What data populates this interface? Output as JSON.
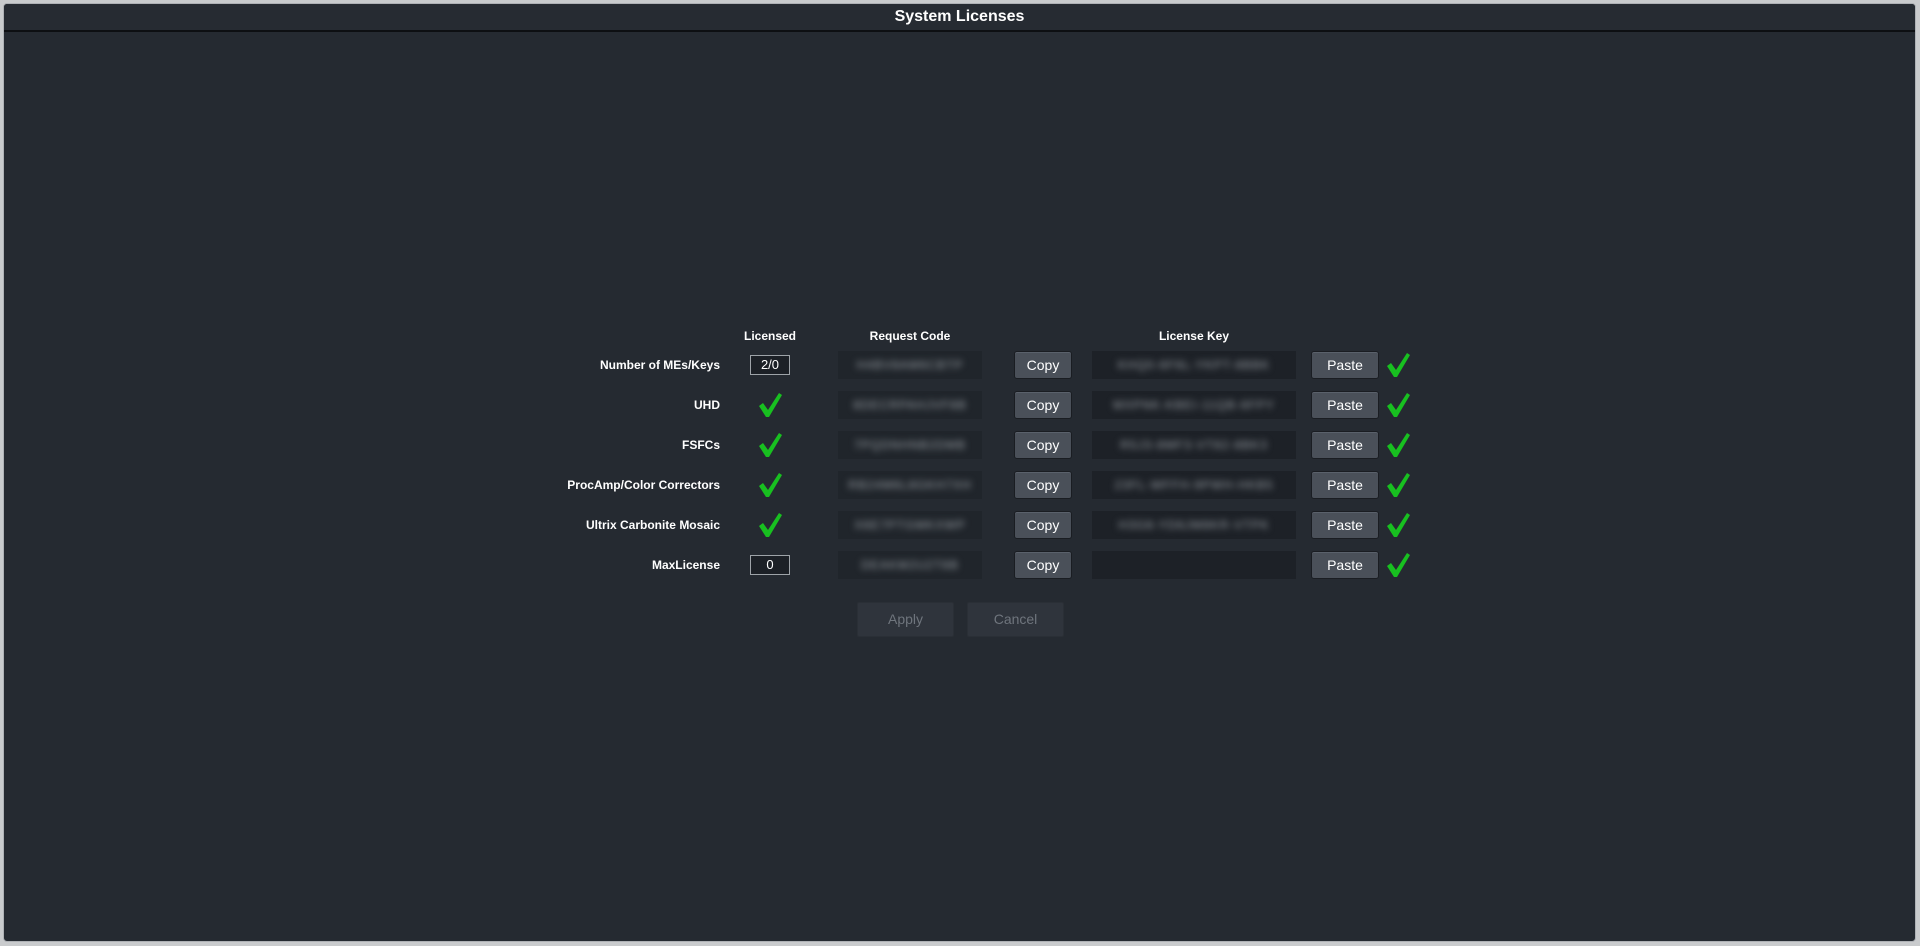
{
  "window": {
    "title": "System Licenses"
  },
  "headers": {
    "licensed": "Licensed",
    "request_code": "Request Code",
    "license_key": "License Key"
  },
  "colors": {
    "background": "#252a31",
    "check": "#18c020",
    "button": "#4a5059"
  },
  "rows": [
    {
      "label": "Number of MEs/Keys",
      "licensed_type": "value",
      "licensed_value": "2/0",
      "request_code": "H4BV8AM6CBTP",
      "copy_label": "Copy",
      "license_key": "KHQ0-6F6L-YKPT-8BBK",
      "paste_label": "Paste",
      "status_icon": "check-icon"
    },
    {
      "label": "UHD",
      "licensed_type": "check",
      "licensed_icon": "check-icon",
      "request_code": "8DECRPAHJVF8B",
      "copy_label": "Copy",
      "license_key": "MXPNK-KBEI-11QB-6FPY",
      "paste_label": "Paste",
      "status_icon": "check-icon"
    },
    {
      "label": "FSFCs",
      "licensed_type": "check",
      "licensed_icon": "check-icon",
      "request_code": "7PQDNHNB2DMB",
      "copy_label": "Copy",
      "license_key": "R5J3-8MF3-VT82-8BK3",
      "paste_label": "Paste",
      "status_icon": "check-icon"
    },
    {
      "label": "ProcAmp/Color Correctors",
      "licensed_type": "check",
      "licensed_icon": "check-icon",
      "request_code": "RB24M6L8GKH7XH",
      "copy_label": "Copy",
      "license_key": "23FL-WFFH-9PWH-HKB5",
      "paste_label": "Paste",
      "status_icon": "check-icon"
    },
    {
      "label": "Ultrix Carbonite Mosaic",
      "licensed_type": "check",
      "licensed_icon": "check-icon",
      "request_code": "X6E7PTGMKXWP",
      "copy_label": "Copy",
      "license_key": "H3G8-YD6JM8KR-VTPK",
      "paste_label": "Paste",
      "status_icon": "check-icon"
    },
    {
      "label": "MaxLicense",
      "licensed_type": "value",
      "licensed_value": "0",
      "request_code": "DEAKM2U2T8B",
      "copy_label": "Copy",
      "license_key": "",
      "paste_label": "Paste",
      "status_icon": "check-icon"
    }
  ],
  "footer": {
    "apply_label": "Apply",
    "cancel_label": "Cancel"
  }
}
